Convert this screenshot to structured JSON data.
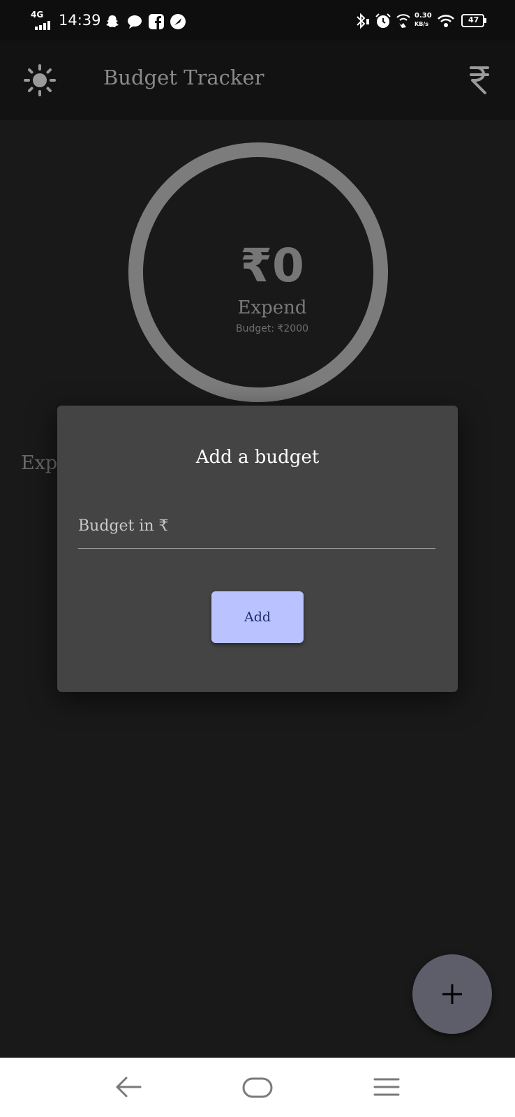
{
  "status_bar": {
    "network": "4G",
    "time": "14:39",
    "speed_value": "0.30",
    "speed_unit": "KB/s",
    "battery": "47"
  },
  "app_bar": {
    "title": "Budget Tracker",
    "left_icon": "sun-icon",
    "right_icon": "rupee-icon"
  },
  "summary": {
    "amount": "₹0",
    "label": "Expend",
    "budget_text": "Budget: ₹2000"
  },
  "section_label": "Expe",
  "dialog": {
    "title": "Add a budget",
    "input_placeholder": "Budget in ₹",
    "input_value": "",
    "add_label": "Add"
  },
  "fab": {
    "icon": "plus-icon"
  },
  "nav": {
    "back_icon": "back-arrow-icon",
    "home_icon": "home-icon",
    "menu_icon": "menu-icon"
  },
  "colors": {
    "background": "#191919",
    "dialog": "#444444",
    "add_button": "#bac3ff",
    "ring": "#7c7c7c",
    "fab": "#5d5e6a"
  }
}
